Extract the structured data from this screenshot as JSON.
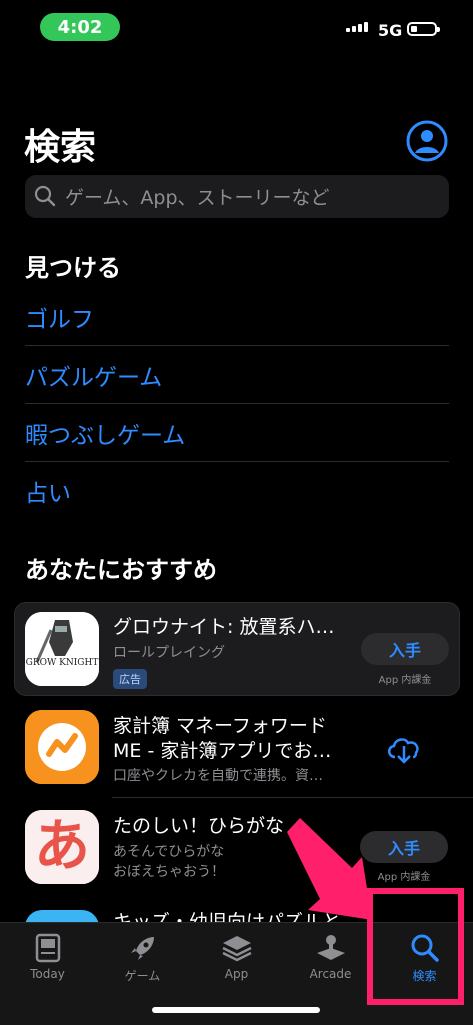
{
  "status": {
    "time": "4:02",
    "network": "5G"
  },
  "page": {
    "title": "検索"
  },
  "search": {
    "placeholder": "ゲーム、App、ストーリーなど"
  },
  "discover": {
    "heading": "見つける",
    "items": [
      "ゴルフ",
      "パズルゲーム",
      "暇つぶしゲーム",
      "占い"
    ]
  },
  "recommend": {
    "heading": "あなたにおすすめ",
    "apps": [
      {
        "name": "グロウナイト: 放置系ハ…",
        "category": "ロールプレイング",
        "badge": "広告",
        "action": "入手",
        "iap": "App 内課金",
        "icon_text": "GROW KNIGHT"
      },
      {
        "name_line1": "家計簿 マネーフォワード",
        "name_line2": "ME - 家計簿アプリでお…",
        "subtitle": "口座やクレカを自動で連携。資…",
        "action_icon": "cloud-download-icon"
      },
      {
        "name": "たのしい！ひらがな",
        "sub_line1": "あそんでひらがな",
        "sub_line2": "おぼえちゃおう！",
        "action": "入手",
        "iap": "App 内課金",
        "icon_text": "あ"
      },
      {
        "name": "キッズ・幼児向けパズルと…"
      }
    ]
  },
  "tabs": [
    {
      "label": "Today",
      "icon": "today-icon"
    },
    {
      "label": "ゲーム",
      "icon": "rocket-icon"
    },
    {
      "label": "App",
      "icon": "layers-icon"
    },
    {
      "label": "Arcade",
      "icon": "joystick-icon"
    },
    {
      "label": "検索",
      "icon": "search-icon",
      "active": true
    }
  ],
  "colors": {
    "accent": "#2f8cff",
    "highlight": "#ff1f6b",
    "time_pill": "#33c759"
  }
}
